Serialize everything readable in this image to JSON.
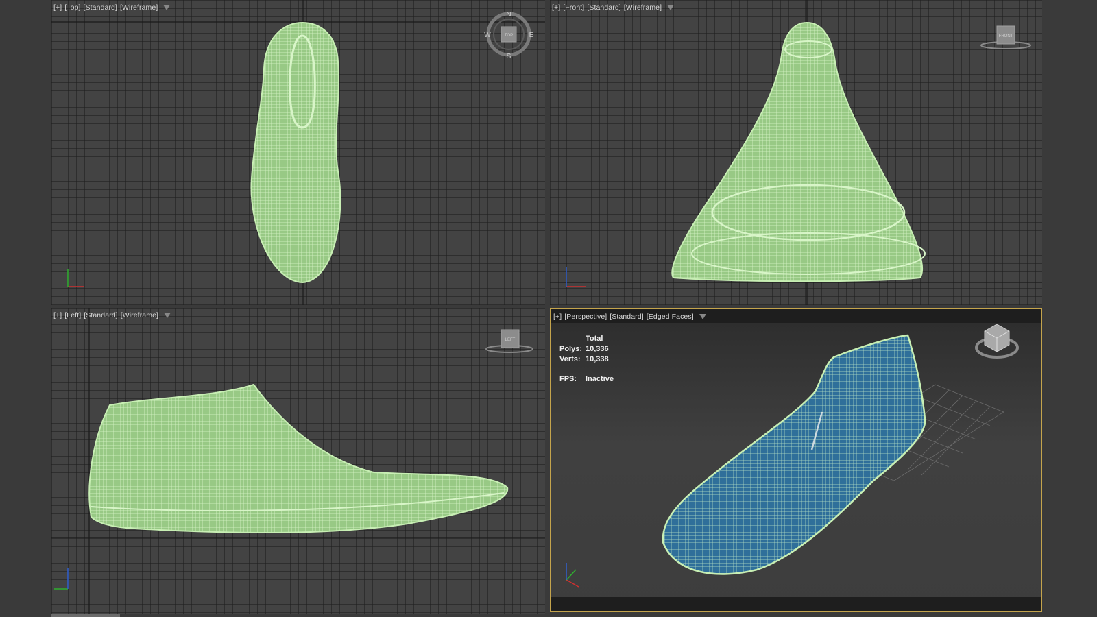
{
  "viewports": {
    "top": {
      "labels": [
        "[+]",
        "[Top]",
        "[Standard]",
        "[Wireframe]"
      ],
      "viewcube": "TOP",
      "compass": {
        "n": "N",
        "s": "S",
        "e": "E",
        "w": "W"
      }
    },
    "front": {
      "labels": [
        "[+]",
        "[Front]",
        "[Standard]",
        "[Wireframe]"
      ],
      "viewcube": "FRONT"
    },
    "left": {
      "labels": [
        "[+]",
        "[Left]",
        "[Standard]",
        "[Wireframe]"
      ],
      "viewcube": "LEFT"
    },
    "perspective": {
      "labels": [
        "[+]",
        "[Perspective]",
        "[Standard]",
        "[Edged Faces]"
      ],
      "stats": {
        "header": "Total",
        "polys_label": "Polys:",
        "polys_value": "10,336",
        "verts_label": "Verts:",
        "verts_value": "10,338",
        "fps_label": "FPS:",
        "fps_value": "Inactive"
      }
    }
  },
  "colors": {
    "wire": "#b7e3a0",
    "wire_dark": "#9ccf86",
    "mesh_blue": "#2f6f9a",
    "active_border": "#c4a44c",
    "axis_x": "#d03030",
    "axis_y": "#30b030",
    "axis_z": "#3060d0"
  },
  "icons": [
    "filter-icon",
    "viewcube-icon",
    "compass-icon",
    "axis-gizmo-icon"
  ]
}
